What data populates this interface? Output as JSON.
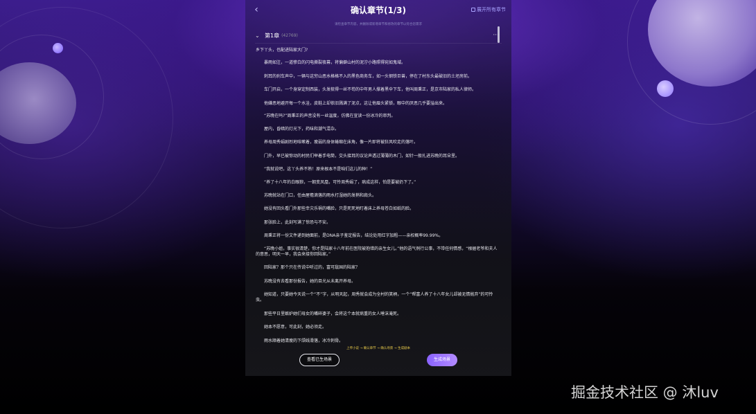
{
  "header": {
    "back_icon": "chevron-left-icon",
    "title": "确认章节(1/3)",
    "expand_all_label": "展开所有章节"
  },
  "hint": "请检查章节内容，并删除或新增章节和修改的章节以符合您需求",
  "chapter": {
    "title": "第1章",
    "count": "(42769)",
    "more": "···"
  },
  "paragraphs": [
    "乡下丫头，也配进陆家大门?",
    "暴雨如注，一道惨白的闪电撕裂夜幕，将偏僻山村的泥泞小路照得宛如鬼域。",
    "刺耳的刹车声中，一辆与这穷山恶水格格不入的黑色商务车，如一头钢铁巨兽，停在了村东头最破旧的土坯房前。",
    "车门开启，一个身穿定制西装，头发梳得一丝不苟的中年男人撑着黑伞下车，他叫周秉正，是京市陆家的私人律师。",
    "他嫌恶地避开每一个水洼，皮鞋上却依旧溅满了泥点，这让他眉头紧锁，眼中的厌恶几乎要溢出来。",
    "“苏晚在吗?”周秉正的声音没有一丝温度，仿佛在宣读一份冰冷的审判。",
    "屋内，昏暗的灯光下，药味和潮气混杂。",
    "养母周秀娟剧烈地咳嗽着，瘦弱的身体蜷缩在床角，像一片即将被狂风吹走的落叶。",
    "门外，早已被惊动的村民们举着手电筒，交头接耳的议论声透过薄薄的木门，如针一般扎进苏晚的耳朵里。",
    "“我就说吧，这丫头养不熟！原来根本不是咱们这儿的种！”",
    "“养了十八年的白眼狼，一朝变凤凰，可怜周秀娟了，病成这样，怕是要被扔下了。”",
    "苏晚就站在门口，任由屋檐滴落的雨水打湿她的发梢和肩头。",
    "她没有回头看门外那些幸灾乐祸的嘴脸，只是死死地盯着床上养母苍白如纸的脸。",
    "那张脸上，此刻写满了惊恐与不安。",
    "周秉正将一份文件递到她面前，是DNA亲子鉴定报告，结论处用红字加粗——亲权概率99.99%。",
    "“苏晚小姐，事实很清楚，你才是陆家十八年前在医院被抱错的亲生女儿。”他的语气例行公事，不带任何情感，“根据老爷和夫人的意思，明天一早，我会来接你回陆家。”",
    "回陆家？那个只在传说中听过的，富可敌国的陆家？",
    "苏晚没有去看那份报告，她的目光从未离开养母。",
    "她知道，只要她今天说一个“不”字，从明天起，周秀就会成为全村的笑柄，一个“帮富人养了十八年女儿却被无情抛弃”的可怜虫。",
    "那些平日里嫉妒她们母女的嘴碎婆子，会将这个本就病重的女人唾沫淹死。",
    "她本不愿意，可此刻，她必须走。",
    "雨水顺着她清瘦的下颌线滑落，冰冷刺骨。"
  ],
  "flow": "上传小说 → 确认章节 → 确认场景 → 生成剧本",
  "buttons": {
    "view_scenes": "查看已生场景",
    "generate": "生成场景"
  },
  "watermark": "掘金技术社区 @ 沐luv",
  "colors": {
    "accent": "#8a63ff",
    "flow_text": "#e6c84a"
  }
}
